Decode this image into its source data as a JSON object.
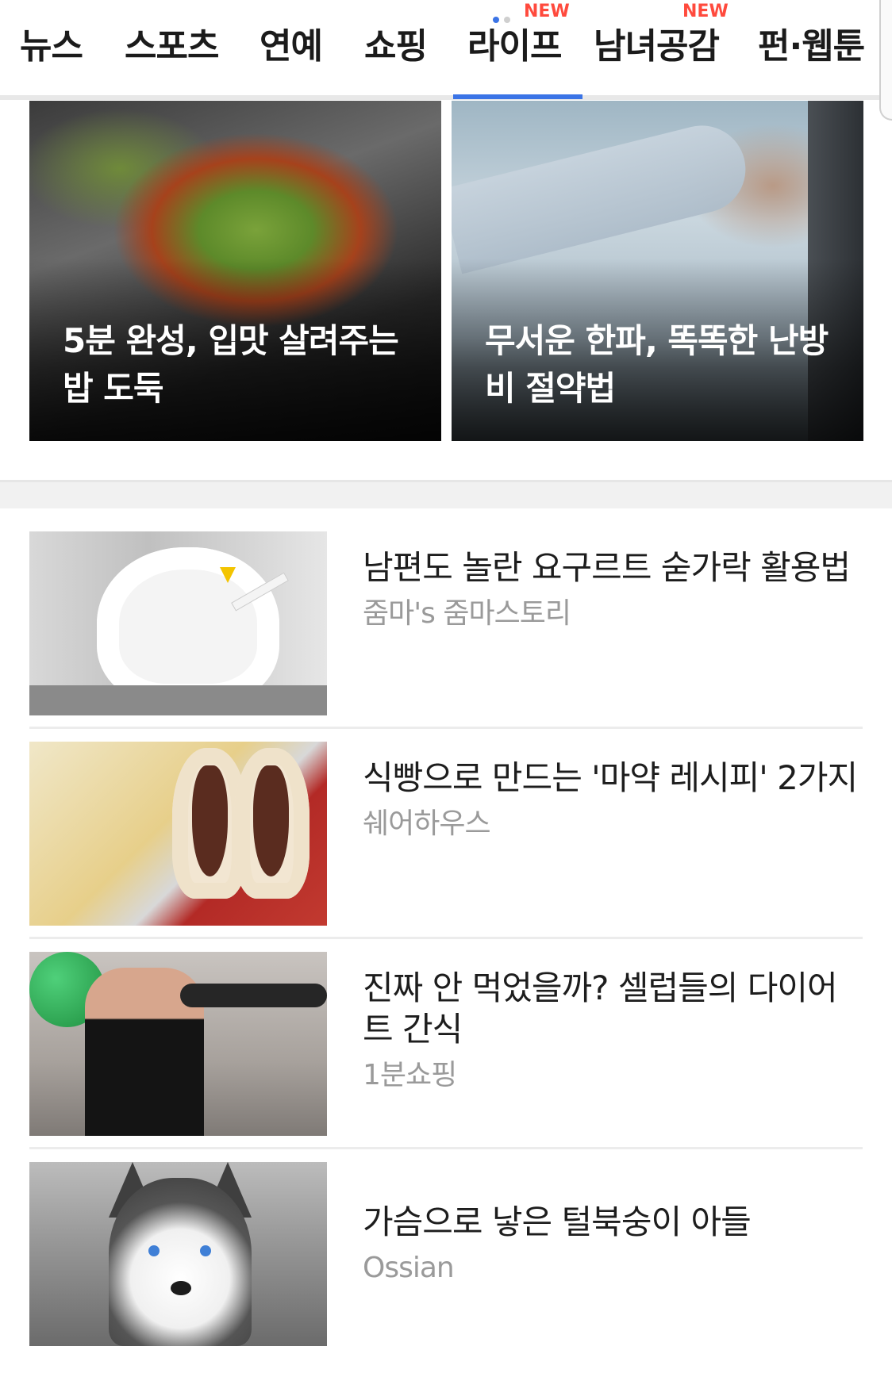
{
  "nav": {
    "tabs": [
      {
        "label": "뉴스"
      },
      {
        "label": "스포츠"
      },
      {
        "label": "연예"
      },
      {
        "label": "쇼핑"
      },
      {
        "label": "라이프",
        "active": true,
        "badge": "NEW"
      },
      {
        "label": "남녀공감",
        "badge": "NEW"
      },
      {
        "label": "펀·웹툰"
      }
    ],
    "accent_color": "#3b74e6",
    "badge_color": "#ff4a3d"
  },
  "hero": [
    {
      "title": "5분 완성, 입맛 살려주는 밥 도둑"
    },
    {
      "title": "무서운 한파, 똑똑한 난방비 절약법"
    }
  ],
  "list": [
    {
      "title": "남편도 놀란 요구르트 숟가락 활용법",
      "source": "줌마's 줌마스토리"
    },
    {
      "title": "식빵으로 만드는 '마약 레시피' 2가지",
      "source": "쉐어하우스"
    },
    {
      "title": "진짜 안 먹었을까? 셀럽들의 다이어트 간식",
      "source": "1분쇼핑"
    },
    {
      "title": "가슴으로 낳은 털북숭이 아들",
      "source": "Ossian"
    }
  ]
}
